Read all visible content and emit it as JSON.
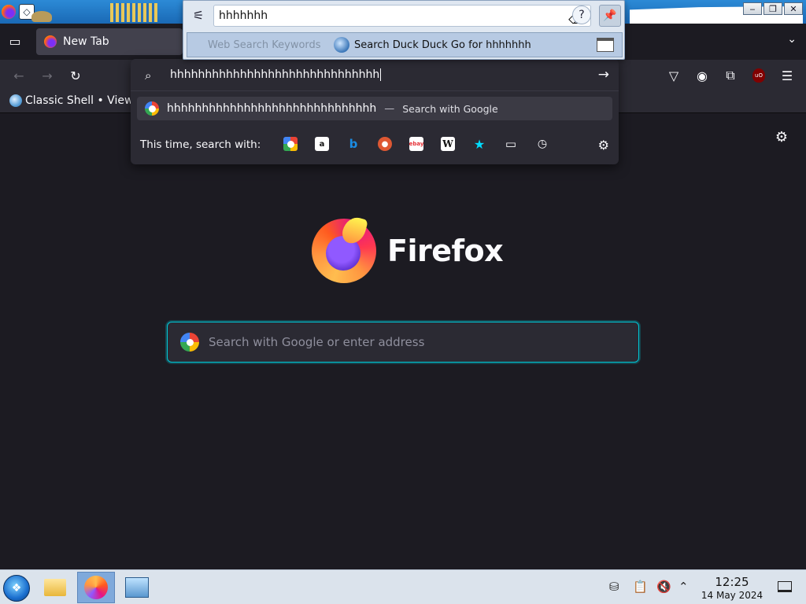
{
  "tab": {
    "title": "New Tab"
  },
  "bookmarks": [
    {
      "label": "Classic Shell • View..."
    }
  ],
  "urlbar": {
    "typed_text": "hhhhhhhhhhhhhhhhhhhhhhhhhhhhhh",
    "suggestion": {
      "text": "hhhhhhhhhhhhhhhhhhhhhhhhhhhhhh",
      "dash": "—",
      "action": "Search with Google"
    },
    "oneoff_label": "This time, search with:",
    "engines": [
      "google-icon",
      "amazon-icon",
      "bing-icon",
      "duckduckgo-icon",
      "ebay-icon",
      "wikipedia-icon",
      "bookmarks-icon",
      "tabs-icon",
      "history-icon"
    ]
  },
  "newtab": {
    "wordmark": "Firefox",
    "search_placeholder": "Search with Google or enter address"
  },
  "keyword_popup": {
    "input_value": "hhhhhhh",
    "hint": "Web Search Keywords",
    "result": "Search Duck Duck Go for hhhhhhh"
  },
  "taskbar": {
    "time": "12:25",
    "date": "14 May 2024"
  }
}
